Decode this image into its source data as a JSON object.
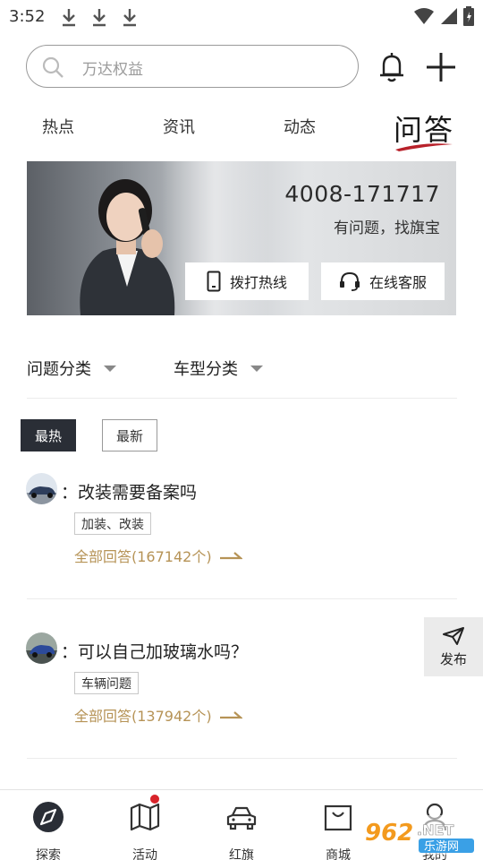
{
  "status_bar": {
    "time": "3:52"
  },
  "header": {
    "search_placeholder": "万达权益"
  },
  "tabs": [
    {
      "label": "热点"
    },
    {
      "label": "资讯"
    },
    {
      "label": "动态"
    },
    {
      "label": "问答",
      "active": true
    }
  ],
  "banner": {
    "phone": "4008-171717",
    "slogan": "有问题，找旗宝",
    "call_label": "拨打热线",
    "service_label": "在线客服"
  },
  "filters": {
    "question_category": "问题分类",
    "car_category": "车型分类"
  },
  "sort": {
    "hot": "最热",
    "new": "最新",
    "active": "hot"
  },
  "questions": [
    {
      "title": "：改装需要备案吗",
      "tag": "加装、改装",
      "answers": "全部回答(167142个)"
    },
    {
      "title": "：可以自己加玻璃水吗？",
      "tag": "车辆问题",
      "answers": "全部回答(137942个)"
    }
  ],
  "publish_label": "发布",
  "bottom_nav": [
    {
      "label": "探索",
      "active": true
    },
    {
      "label": "活动",
      "badge": true
    },
    {
      "label": "红旗"
    },
    {
      "label": "商城"
    },
    {
      "label": "我的"
    }
  ],
  "watermark": {
    "number": "962",
    "suffix": ".NET",
    "name": "乐游网"
  },
  "colors": {
    "accent_gold": "#b69356",
    "dark_button": "#2a2e36",
    "badge_red": "#d8232a"
  }
}
